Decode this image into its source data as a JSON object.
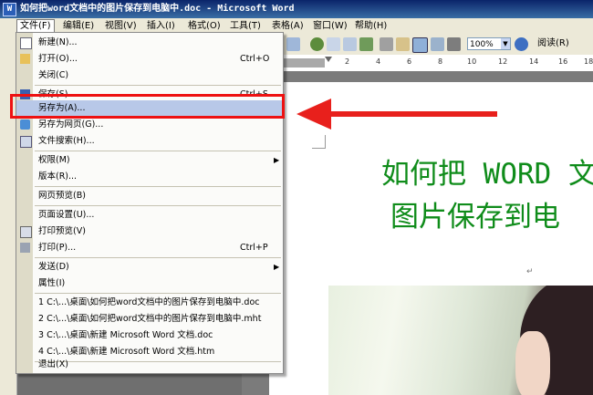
{
  "window": {
    "title": "如何把word文档中的图片保存到电脑中.doc - Microsoft Word"
  },
  "menubar": [
    {
      "label": "文件(F)",
      "active": true
    },
    {
      "label": "编辑(E)"
    },
    {
      "label": "视图(V)"
    },
    {
      "label": "插入(I)"
    },
    {
      "label": "格式(O)"
    },
    {
      "label": "工具(T)"
    },
    {
      "label": "表格(A)"
    },
    {
      "label": "窗口(W)"
    },
    {
      "label": "帮助(H)"
    }
  ],
  "toolbar": {
    "zoom": "100%",
    "read_label": "阅读(R)"
  },
  "ruler": {
    "labels": [
      "2",
      "4",
      "6",
      "8",
      "10",
      "12",
      "14",
      "16",
      "18"
    ]
  },
  "file_menu": {
    "items": [
      {
        "label": "新建(N)...",
        "icon": "new-doc-icon"
      },
      {
        "label": "打开(O)...",
        "shortcut": "Ctrl+O",
        "icon": "open-folder-icon"
      },
      {
        "label": "关闭(C)"
      },
      {
        "label": "保存(S)",
        "shortcut": "Ctrl+S",
        "icon": "save-icon"
      },
      {
        "label": "另存为(A)...",
        "highlighted": true
      },
      {
        "label": "另存为网页(G)...",
        "icon": "web-page-icon"
      },
      {
        "label": "文件搜索(H)...",
        "icon": "file-search-icon"
      },
      {
        "label": "权限(M)",
        "submenu": true
      },
      {
        "label": "版本(R)..."
      },
      {
        "label": "网页预览(B)"
      },
      {
        "label": "页面设置(U)..."
      },
      {
        "label": "打印预览(V)",
        "icon": "print-preview-icon"
      },
      {
        "label": "打印(P)...",
        "shortcut": "Ctrl+P",
        "icon": "printer-icon"
      },
      {
        "label": "发送(D)",
        "submenu": true
      },
      {
        "label": "属性(I)"
      },
      {
        "label": "1 C:\\...\\桌面\\如何把word文档中的图片保存到电脑中.doc"
      },
      {
        "label": "2 C:\\...\\桌面\\如何把word文档中的图片保存到电脑中.mht"
      },
      {
        "label": "3 C:\\...\\桌面\\新建 Microsoft Word 文档.doc"
      },
      {
        "label": "4 C:\\...\\桌面\\新建 Microsoft Word 文档.htm"
      },
      {
        "label": "退出(X)"
      }
    ]
  },
  "document": {
    "heading_line1": "如何把 WORD 文",
    "heading_line2": "图片保存到电",
    "para_mark": "↵"
  },
  "colors": {
    "heading": "#0f8c1a",
    "highlight_box": "#ee1111",
    "arrow": "#e8201c",
    "menu_hover": "#b8c8e8"
  }
}
